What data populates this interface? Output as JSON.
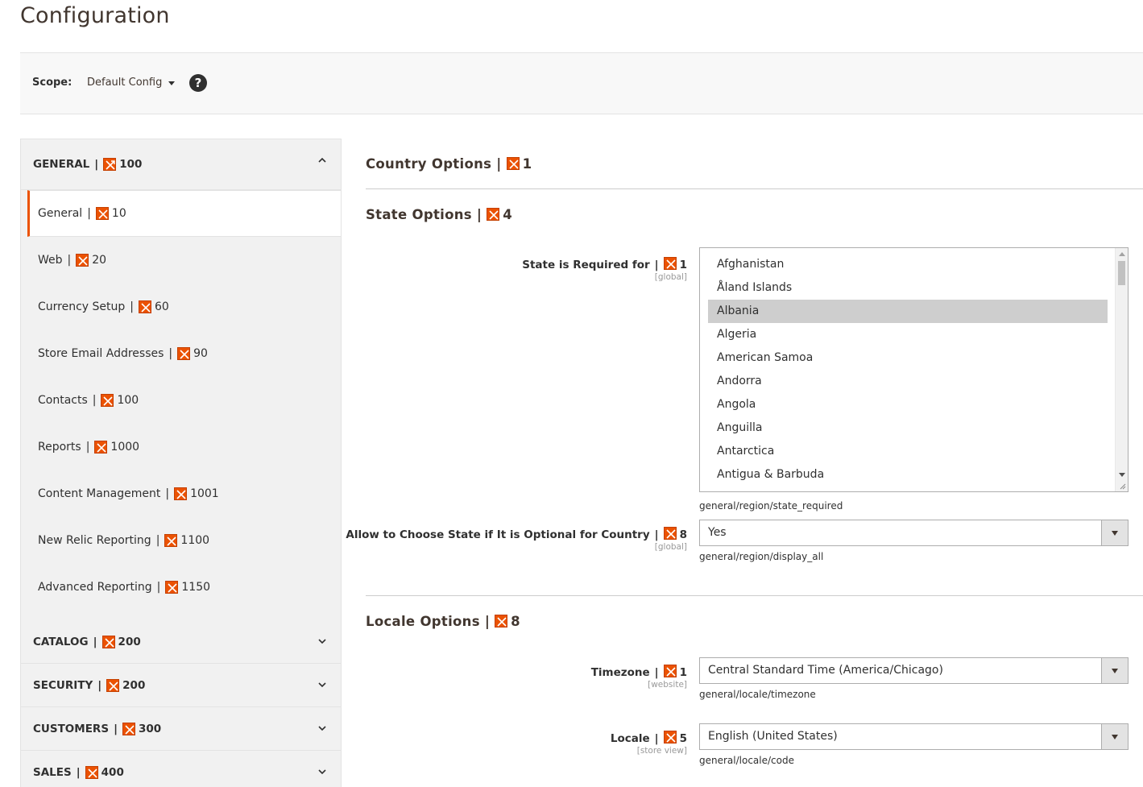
{
  "page": {
    "title": "Configuration"
  },
  "scope": {
    "label": "Scope:",
    "value": "Default Config",
    "help": "?"
  },
  "sidebar": {
    "groups": [
      {
        "label": "GENERAL",
        "sep": "|",
        "id": "100",
        "state": "open"
      },
      {
        "label": "CATALOG",
        "sep": "|",
        "id": "200",
        "state": "closed"
      },
      {
        "label": "SECURITY",
        "sep": "|",
        "id": "200",
        "state": "closed"
      },
      {
        "label": "CUSTOMERS",
        "sep": "|",
        "id": "300",
        "state": "closed"
      },
      {
        "label": "SALES",
        "sep": "|",
        "id": "400",
        "state": "closed"
      }
    ],
    "items": [
      {
        "label": "General",
        "sep": "|",
        "id": "10",
        "active": true
      },
      {
        "label": "Web",
        "sep": "|",
        "id": "20"
      },
      {
        "label": "Currency Setup",
        "sep": "|",
        "id": "60"
      },
      {
        "label": "Store Email Addresses",
        "sep": "|",
        "id": "90"
      },
      {
        "label": "Contacts",
        "sep": "|",
        "id": "100"
      },
      {
        "label": "Reports",
        "sep": "|",
        "id": "1000"
      },
      {
        "label": "Content Management",
        "sep": "|",
        "id": "1001"
      },
      {
        "label": "New Relic Reporting",
        "sep": "|",
        "id": "1100"
      },
      {
        "label": "Advanced Reporting",
        "sep": "|",
        "id": "1150"
      }
    ]
  },
  "main": {
    "sections": [
      {
        "title": "Country Options",
        "sep": "|",
        "id": "1"
      },
      {
        "title": "State Options",
        "sep": "|",
        "id": "4"
      },
      {
        "title": "Locale Options",
        "sep": "|",
        "id": "8"
      }
    ],
    "fields": {
      "state_required": {
        "label": "State is Required for",
        "sep": "|",
        "id": "1",
        "scope": "[global]",
        "options": [
          "Afghanistan",
          "Åland Islands",
          "Albania",
          "Algeria",
          "American Samoa",
          "Andorra",
          "Angola",
          "Anguilla",
          "Antarctica",
          "Antigua & Barbuda"
        ],
        "selected_index": 2,
        "path": "general/region/state_required"
      },
      "display_all": {
        "label": "Allow to Choose State if It is Optional for Country",
        "sep": "|",
        "id": "8",
        "scope": "[global]",
        "value": "Yes",
        "path": "general/region/display_all"
      },
      "timezone": {
        "label": "Timezone",
        "sep": "|",
        "id": "1",
        "scope": "[website]",
        "value": "Central Standard Time (America/Chicago)",
        "path": "general/locale/timezone"
      },
      "locale": {
        "label": "Locale",
        "sep": "|",
        "id": "5",
        "scope": "[store view]",
        "value": "English (United States)",
        "path": "general/locale/code"
      }
    }
  },
  "colors": {
    "accent": "#eb5202",
    "sidebar_bg": "#f1f1f1",
    "selected_option": "#cecece"
  }
}
